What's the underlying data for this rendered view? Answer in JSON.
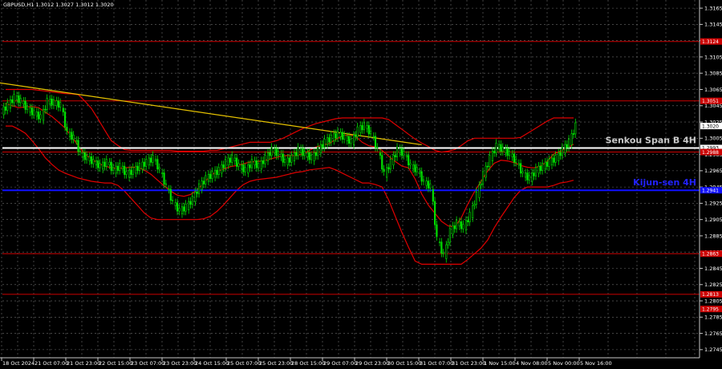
{
  "chart_data": {
    "type": "candlestick",
    "title": "GBPUSD,H1  1.3012 1.3027 1.3012 1.3020",
    "ylim": [
      1.2735,
      1.3175
    ],
    "y_ticks": [
      "1.3165",
      "1.3145",
      "1.3125",
      "1.3105",
      "1.3085",
      "1.3065",
      "1.3045",
      "1.3025",
      "1.3005",
      "1.2985",
      "1.2965",
      "1.2945",
      "1.2925",
      "1.2905",
      "1.2885",
      "1.2865",
      "1.2845",
      "1.2825",
      "1.2805",
      "1.2785",
      "1.2765",
      "1.2745"
    ],
    "x_ticks": [
      "18 Oct 2024",
      "21 Oct 07:00",
      "21 Oct 23:00",
      "22 Oct 15:00",
      "23 Oct 07:00",
      "23 Oct 23:00",
      "24 Oct 15:00",
      "25 Oct 07:00",
      "25 Oct 23:00",
      "28 Oct 15:00",
      "29 Oct 07:00",
      "29 Oct 23:00",
      "30 Oct 15:00",
      "31 Oct 07:00",
      "31 Oct 23:00",
      "1 Nov 15:00",
      "4 Nov 08:00",
      "5 Nov 00:00",
      "5 Nov 16:00"
    ],
    "current_price": "1.3020",
    "price_path": [
      1.3045,
      1.3055,
      1.305,
      1.304,
      1.3035,
      1.303,
      1.305,
      1.3048,
      1.3045,
      1.301,
      1.3005,
      1.2985,
      1.298,
      1.2975,
      1.297,
      1.2975,
      1.2965,
      1.297,
      1.296,
      1.2965,
      1.297,
      1.2975,
      1.298,
      1.2965,
      1.2945,
      1.2925,
      1.2915,
      1.292,
      1.293,
      1.2945,
      1.2955,
      1.296,
      1.2965,
      1.2975,
      1.298,
      1.297,
      1.2965,
      1.2975,
      1.297,
      1.298,
      1.299,
      1.2985,
      1.2975,
      1.298,
      1.299,
      1.2985,
      1.298,
      1.299,
      1.3,
      1.3005,
      1.301,
      1.3005,
      1.3,
      1.3015,
      1.302,
      1.301,
      1.299,
      1.296,
      1.2975,
      1.299,
      1.2985,
      1.297,
      1.2965,
      1.295,
      1.2945,
      1.288,
      1.286,
      1.289,
      1.29,
      1.2895,
      1.291,
      1.2935,
      1.296,
      1.298,
      1.2995,
      1.299,
      1.2985,
      1.2975,
      1.296,
      1.2955,
      1.2965,
      1.297,
      1.2975,
      1.298,
      1.299,
      1.3,
      1.302
    ],
    "lines": [
      {
        "name": "Senkou Span B 4H",
        "value": 1.2993,
        "color": "#ffffff",
        "label_color": "#c8c8c8"
      },
      {
        "name": "Kijun-sen 4H",
        "value": 1.2941,
        "color": "#1010ff",
        "label_color": "#2222ff"
      }
    ],
    "red_levels": [
      1.3124,
      1.3051,
      1.2988,
      1.2863,
      1.2813
    ],
    "level_boxes": [
      "1.3124",
      "1.3051",
      "1.2993",
      "1.2988",
      "1.2941",
      "1.2863",
      "1.2813",
      "1.2795"
    ],
    "trendline": {
      "color": "#e6c200",
      "from": [
        0,
        1.3073
      ],
      "to": [
        63,
        1.2997
      ]
    },
    "colors": {
      "background": "#000000",
      "grid": "#6e6e6e",
      "bull": "#00e000",
      "bear": "#00e000",
      "bands": "#e00000"
    }
  }
}
